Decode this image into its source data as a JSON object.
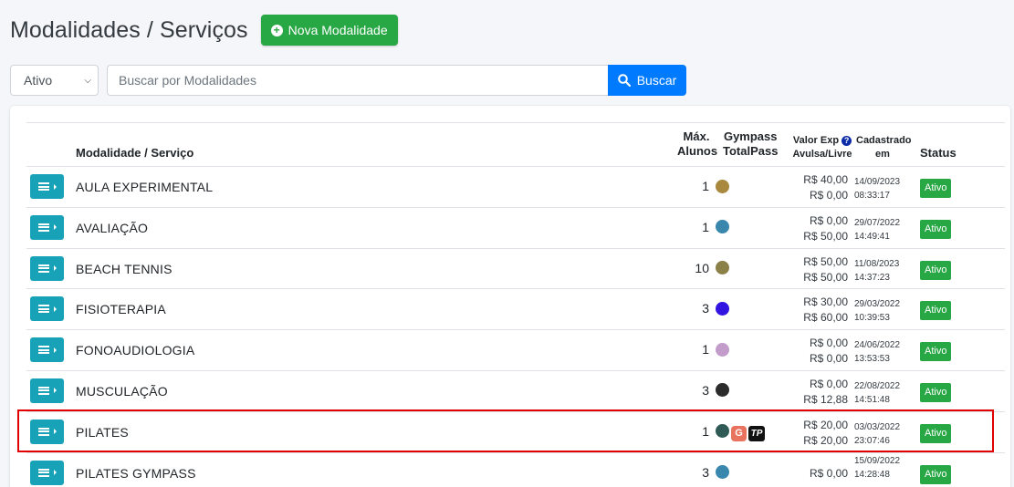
{
  "header": {
    "title": "Modalidades / Serviços",
    "new_button": "Nova Modalidade"
  },
  "filter": {
    "status_value": "Ativo",
    "search_placeholder": "Buscar por Modalidades",
    "search_button": "Buscar"
  },
  "table": {
    "headers": {
      "name": "Modalidade / Serviço",
      "max_line1": "Máx.",
      "max_line2": "Alunos",
      "gym_line1": "Gympass",
      "gym_line2": "TotalPass",
      "valor_line1": "Valor Exp",
      "valor_line2": "Avulsa/Livre",
      "cad_line1": "Cadastrado",
      "cad_line2": "em",
      "status": "Status"
    },
    "rows": [
      {
        "name": "AULA EXPERIMENTAL",
        "max": "1",
        "color": "#a8893d",
        "price1": "R$ 40,00",
        "price2": "R$ 0,00",
        "date": "14/09/2023",
        "time": "08:33:17",
        "status": "Ativo"
      },
      {
        "name": "AVALIAÇÃO",
        "max": "1",
        "color": "#3a87ad",
        "price1": "R$ 0,00",
        "price2": "R$ 50,00",
        "date": "29/07/2022",
        "time": "14:49:41",
        "status": "Ativo"
      },
      {
        "name": "BEACH TENNIS",
        "max": "10",
        "color": "#8c8049",
        "price1": "R$ 50,00",
        "price2": "R$ 50,00",
        "date": "11/08/2023",
        "time": "14:37:23",
        "status": "Ativo"
      },
      {
        "name": "FISIOTERAPIA",
        "max": "3",
        "color": "#3214e0",
        "price1": "R$ 30,00",
        "price2": "R$ 60,00",
        "date": "29/03/2022",
        "time": "10:39:53",
        "status": "Ativo"
      },
      {
        "name": "FONOAUDIOLOGIA",
        "max": "1",
        "color": "#c39ccb",
        "price1": "R$ 0,00",
        "price2": "R$ 0,00",
        "date": "24/06/2022",
        "time": "13:53:53",
        "status": "Ativo"
      },
      {
        "name": "MUSCULAÇÃO",
        "max": "3",
        "color": "#2b2b2b",
        "price1": "R$ 0,00",
        "price2": "R$ 12,88",
        "date": "22/08/2022",
        "time": "14:51:48",
        "status": "Ativo"
      },
      {
        "name": "PILATES",
        "max": "1",
        "color": "#2f5a55",
        "gym_g": "G",
        "gym_t": "TP",
        "price1": "R$ 20,00",
        "price2": "R$ 20,00",
        "date": "03/03/2022",
        "time": "23:07:46",
        "status": "Ativo"
      },
      {
        "name": "PILATES GYMPASS",
        "max": "3",
        "color": "#3a87ad",
        "price1": "R$ 0,00",
        "date": "15/09/2022",
        "time": "14:28:48",
        "status": "Ativo"
      }
    ]
  }
}
